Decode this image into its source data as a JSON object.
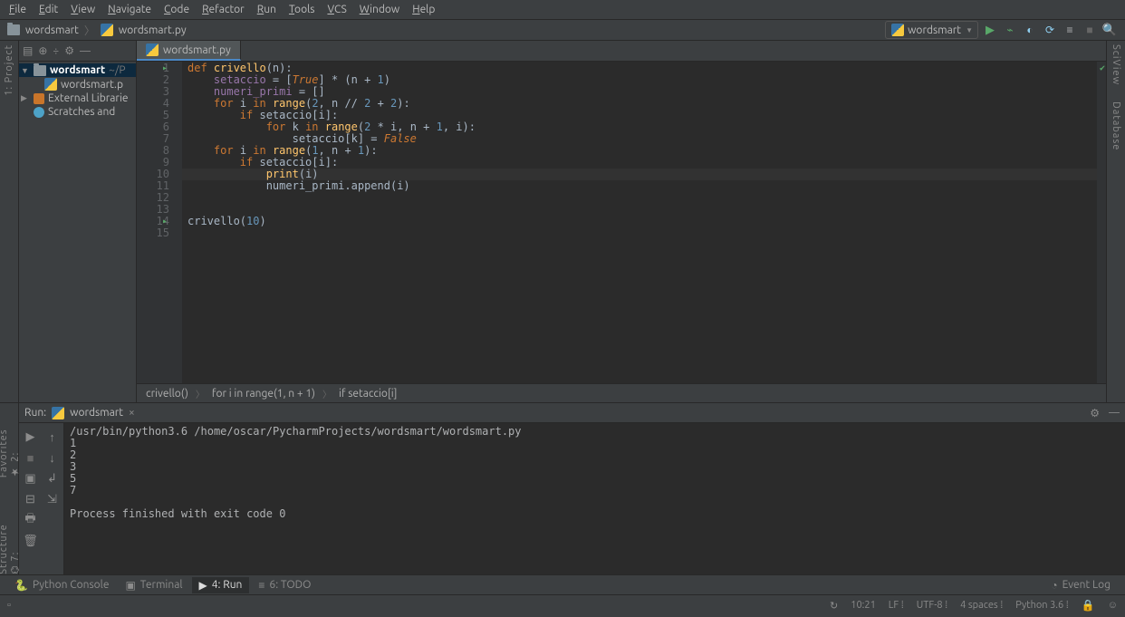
{
  "menu": [
    "File",
    "Edit",
    "View",
    "Navigate",
    "Code",
    "Refactor",
    "Run",
    "Tools",
    "VCS",
    "Window",
    "Help"
  ],
  "nav": {
    "project": "wordsmart",
    "file": "wordsmart.py"
  },
  "run_config": "wordsmart",
  "side_left": [
    "1: Project"
  ],
  "side_right": [
    "SciView",
    "Database"
  ],
  "project_tree": {
    "root": "wordsmart",
    "root_path": "~/P",
    "file": "wordsmart.p",
    "ext": "External Librarie",
    "scratch": "Scratches and"
  },
  "tab": "wordsmart.py",
  "gutter_lines": [
    "1",
    "2",
    "3",
    "4",
    "5",
    "6",
    "7",
    "8",
    "9",
    "10",
    "11",
    "12",
    "13",
    "14",
    "15"
  ],
  "highlight_line": 10,
  "code_tokens": [
    [
      [
        "kw",
        "def "
      ],
      [
        "fn",
        "crivello"
      ],
      [
        "op",
        "(n):"
      ]
    ],
    [
      [
        "op",
        "    "
      ],
      [
        "id",
        "setaccio"
      ],
      [
        "op",
        " = ["
      ],
      [
        "bl",
        "True"
      ],
      [
        "op",
        "] * (n + "
      ],
      [
        "nm",
        "1"
      ],
      [
        "op",
        ")"
      ]
    ],
    [
      [
        "op",
        "    "
      ],
      [
        "id",
        "numeri_primi"
      ],
      [
        "op",
        " = []"
      ]
    ],
    [
      [
        "op",
        "    "
      ],
      [
        "kw",
        "for "
      ],
      [
        "op",
        "i "
      ],
      [
        "kw",
        "in "
      ],
      [
        "fn",
        "range"
      ],
      [
        "op",
        "("
      ],
      [
        "nm",
        "2"
      ],
      [
        "op",
        ", n // "
      ],
      [
        "nm",
        "2"
      ],
      [
        "op",
        " + "
      ],
      [
        "nm",
        "2"
      ],
      [
        "op",
        "):"
      ]
    ],
    [
      [
        "op",
        "        "
      ],
      [
        "kw",
        "if "
      ],
      [
        "op",
        "setaccio[i]:"
      ]
    ],
    [
      [
        "op",
        "            "
      ],
      [
        "kw",
        "for "
      ],
      [
        "op",
        "k "
      ],
      [
        "kw",
        "in "
      ],
      [
        "fn",
        "range"
      ],
      [
        "op",
        "("
      ],
      [
        "nm",
        "2"
      ],
      [
        "op",
        " * i, n + "
      ],
      [
        "nm",
        "1"
      ],
      [
        "op",
        ", i):"
      ]
    ],
    [
      [
        "op",
        "                setaccio[k] = "
      ],
      [
        "bl",
        "False"
      ]
    ],
    [
      [
        "op",
        "    "
      ],
      [
        "kw",
        "for "
      ],
      [
        "op",
        "i "
      ],
      [
        "kw",
        "in "
      ],
      [
        "fn",
        "range"
      ],
      [
        "op",
        "("
      ],
      [
        "nm",
        "1"
      ],
      [
        "op",
        ", n + "
      ],
      [
        "nm",
        "1"
      ],
      [
        "op",
        "):"
      ]
    ],
    [
      [
        "op",
        "        "
      ],
      [
        "kw",
        "if "
      ],
      [
        "op",
        "setaccio[i]:"
      ]
    ],
    [
      [
        "op",
        "            "
      ],
      [
        "fn",
        "print"
      ],
      [
        "op",
        "("
      ],
      [
        "op",
        "i"
      ],
      [
        "op",
        ")"
      ]
    ],
    [
      [
        "op",
        "            numeri_primi.append(i)"
      ]
    ],
    [],
    [],
    [
      [
        "op",
        "crivello("
      ],
      [
        "nm",
        "10"
      ],
      [
        "op",
        ")"
      ]
    ],
    []
  ],
  "breadcrumb": [
    "crivello()",
    "for i in range(1, n + 1)",
    "if setaccio[i]"
  ],
  "run_panel": {
    "title": "Run:",
    "config": "wordsmart",
    "output": "/usr/bin/python3.6 /home/oscar/PycharmProjects/wordsmart/wordsmart.py\n1\n2\n3\n5\n7\n\nProcess finished with exit code 0"
  },
  "bottom_tabs": {
    "console": "Python Console",
    "terminal": "Terminal",
    "run": "4: Run",
    "todo": "6: TODO",
    "eventlog": "Event Log"
  },
  "status": {
    "pos": "10:21",
    "eol": "LF",
    "enc": "UTF-8",
    "indent": "4 spaces",
    "python": "Python 3.6"
  }
}
